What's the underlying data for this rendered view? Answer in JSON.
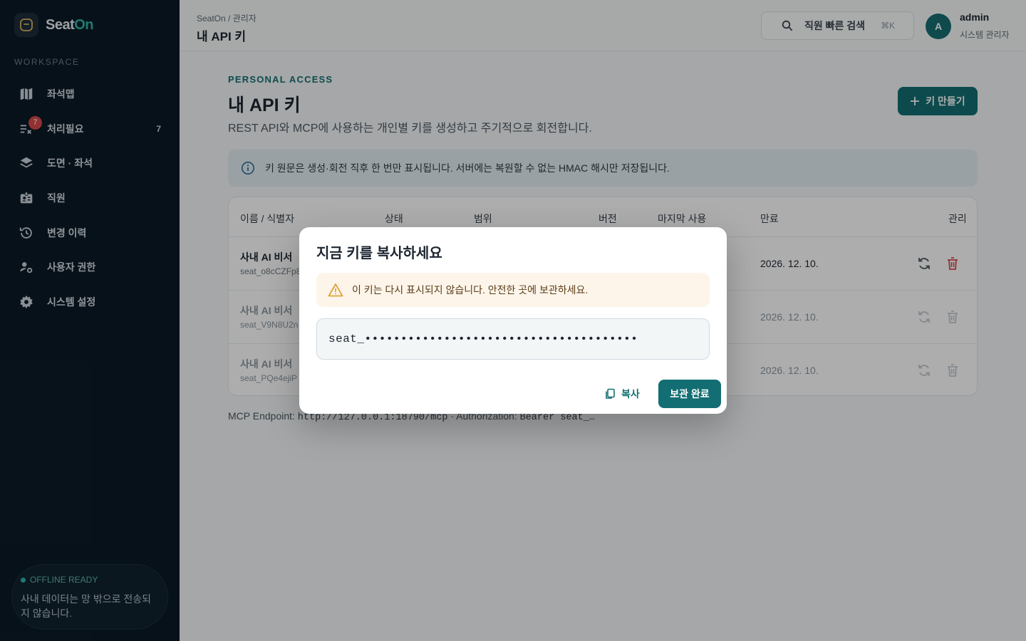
{
  "brand": {
    "name_prefix": "Seat",
    "name_suffix": "On"
  },
  "sidebar": {
    "section_label": "WORKSPACE",
    "items": [
      {
        "label": "좌석맵",
        "icon": "map-icon"
      },
      {
        "label": "처리필요",
        "icon": "checklist-icon",
        "badge": "7",
        "count": "7"
      },
      {
        "label": "도면 · 좌석",
        "icon": "layers-icon"
      },
      {
        "label": "직원",
        "icon": "id-card-icon"
      },
      {
        "label": "변경 이력",
        "icon": "history-icon"
      },
      {
        "label": "사용자 권한",
        "icon": "user-cog-icon"
      },
      {
        "label": "시스템 설정",
        "icon": "gear-icon"
      }
    ],
    "offline": {
      "title": "OFFLINE READY",
      "text": "사내 데이터는 망 밖으로 전송되지 않습니다."
    }
  },
  "header": {
    "breadcrumb": "SeatOn / 관리자",
    "title": "내 API 키",
    "search_label": "직원 빠른 검색",
    "shortcut": "⌘K",
    "user_initial": "A",
    "user_name": "admin",
    "user_role": "시스템 관리자"
  },
  "main": {
    "eyebrow": "PERSONAL ACCESS",
    "title": "내 API 키",
    "description": "REST API와 MCP에 사용하는 개인별 키를 생성하고 주기적으로 회전합니다.",
    "create_label": "키 만들기",
    "info": "키 원문은 생성·회전 직후 한 번만 표시됩니다. 서버에는 복원할 수 없는 HMAC 해시만 저장됩니다.",
    "table": {
      "columns": [
        "이름 / 식별자",
        "상태",
        "범위",
        "버전",
        "마지막 사용",
        "만료",
        "관리"
      ],
      "rows": [
        {
          "name": "사내 AI 비서",
          "id": "seat_o8cCZFp8",
          "expires": "2026. 12. 10."
        },
        {
          "name": "사내 AI 비서",
          "id": "seat_V9N8U2n",
          "expires": "2026. 12. 10."
        },
        {
          "name": "사내 AI 비서",
          "id": "seat_PQe4ejiP",
          "expires": "2026. 12. 10."
        }
      ]
    },
    "endpoint_label": "MCP Endpoint:",
    "endpoint_url": "http://127.0.0.1:18790/mcp",
    "auth_label": "· Authorization:",
    "auth_value": "Bearer seat_…"
  },
  "modal": {
    "title": "지금 키를 복사하세요",
    "warning": "이 키는 다시 표시되지 않습니다. 안전한 곳에 보관하세요.",
    "key_masked": "seat_••••••••••••••••••••••••••••••••••••••",
    "copy_label": "복사",
    "done_label": "보관 완료"
  },
  "colors": {
    "accent": "#126e72",
    "sidebar": "#0b1a26",
    "danger": "#d6494a",
    "warning": "#e0a23a"
  }
}
